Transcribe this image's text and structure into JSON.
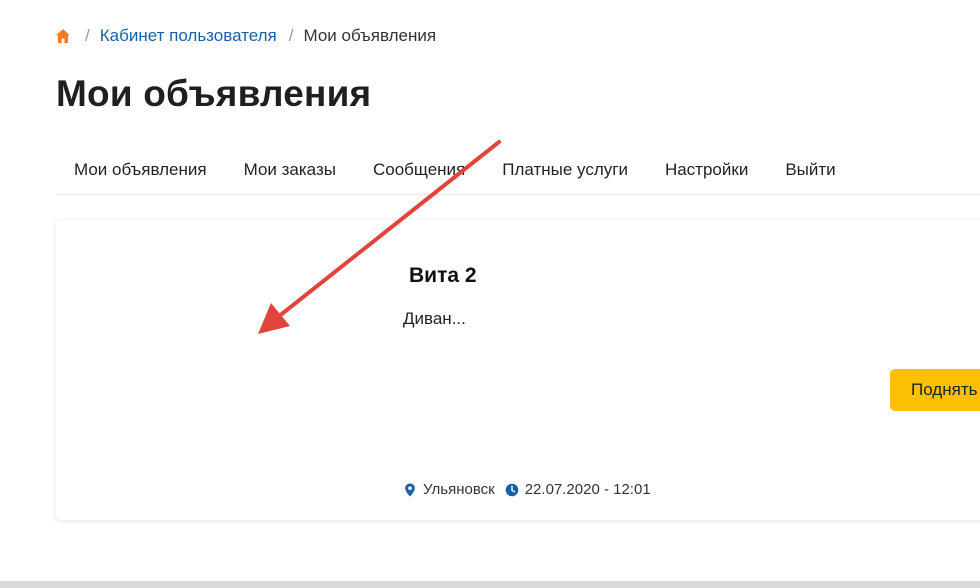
{
  "breadcrumb": {
    "home_icon": "home-icon",
    "separator": "/",
    "items": [
      {
        "label": "Кабинет пользователя"
      },
      {
        "label": "Мои объявления"
      }
    ]
  },
  "page_title": "Мои объявления",
  "tabs": [
    {
      "label": "Мои объявления"
    },
    {
      "label": "Мои заказы"
    },
    {
      "label": "Сообщения"
    },
    {
      "label": "Платные услуги"
    },
    {
      "label": "Настройки"
    },
    {
      "label": "Выйти"
    }
  ],
  "ad": {
    "title": "Вита 2",
    "description": "Диван...",
    "raise_button_label": "Поднять",
    "city": "Ульяновск",
    "date": "22.07.2020 - 12:01",
    "city_icon": "location-pin-icon",
    "date_icon": "clock-icon"
  },
  "colors": {
    "accent": "#fbc002",
    "link": "#1a5fa8",
    "home_icon": "#f47b20",
    "arrow": "#e0443b"
  }
}
